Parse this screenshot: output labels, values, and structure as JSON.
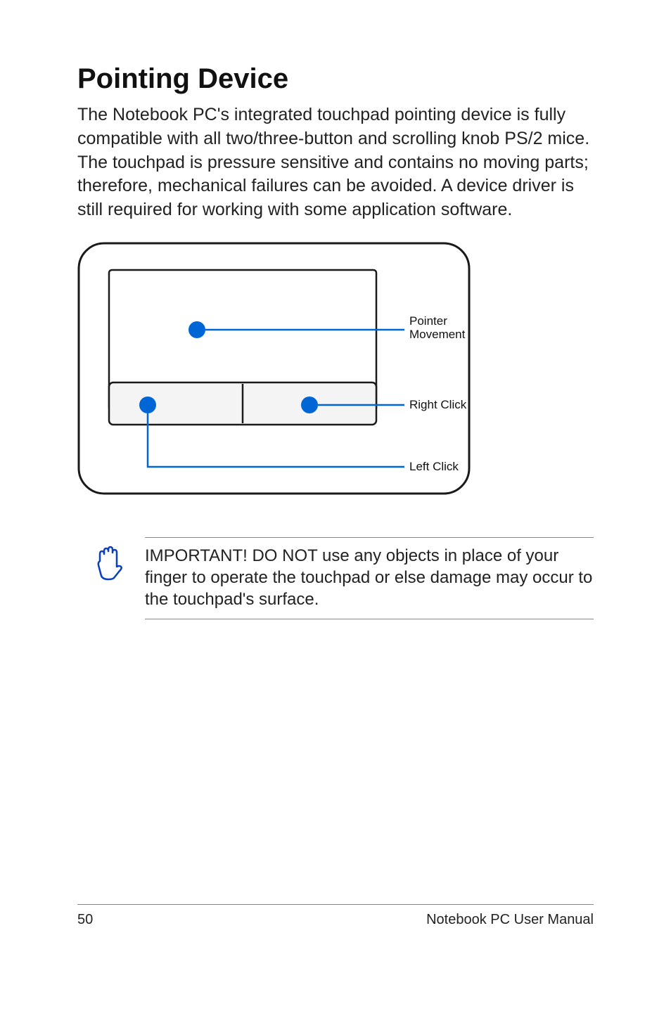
{
  "title": "Pointing Device",
  "intro": "The Notebook PC's integrated touchpad pointing device is fully compatible with all two/three-button and scrolling knob PS/2 mice. The touchpad is pressure sensitive and contains no moving parts; therefore, mechanical failures can be avoided. A device driver is still required for working with some application software.",
  "diagram": {
    "labels": {
      "pointer_movement_line1": "Pointer",
      "pointer_movement_line2": "Movement",
      "right_click": "Right Click",
      "left_click": "Left Click"
    }
  },
  "notice": {
    "icon": "hand-stop-icon",
    "text": "IMPORTANT! DO NOT use any objects in place of your finger to operate the touchpad or else damage may occur to the touchpad's surface."
  },
  "footer": {
    "page_number": "50",
    "manual_title": "Notebook PC User Manual"
  }
}
